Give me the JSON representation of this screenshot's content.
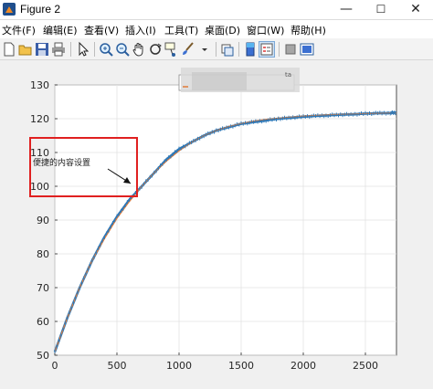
{
  "window": {
    "title": "Figure 2",
    "minimize": "—",
    "maximize": "☐",
    "close": "✕"
  },
  "menu": {
    "items": [
      "文件(F)",
      "编辑(E)",
      "查看(V)",
      "插入(I)",
      "工具(T)",
      "桌面(D)",
      "窗口(W)",
      "帮助(H)"
    ]
  },
  "toolbar": {
    "buttons": [
      {
        "name": "new-figure-icon"
      },
      {
        "name": "open-file-icon"
      },
      {
        "name": "save-icon"
      },
      {
        "name": "print-icon"
      },
      {
        "name": "pointer-icon"
      },
      {
        "name": "zoom-in-icon"
      },
      {
        "name": "zoom-out-icon"
      },
      {
        "name": "pan-icon"
      },
      {
        "name": "rotate-3d-icon"
      },
      {
        "name": "data-cursor-icon"
      },
      {
        "name": "brush-icon"
      },
      {
        "name": "link-plot-icon"
      },
      {
        "name": "insert-colorbar-icon"
      },
      {
        "name": "insert-legend-icon"
      },
      {
        "name": "hide-plot-tools-icon"
      },
      {
        "name": "show-plot-tools-icon"
      }
    ]
  },
  "annotation": {
    "text": "便捷的内容设置",
    "box_color": "#e02020"
  },
  "legend": {
    "visible_fragment": "ta"
  },
  "colors": {
    "series_data": "#2e78b7",
    "series_fit": "#e07b39"
  },
  "chart_data": {
    "type": "line",
    "title": "",
    "xlabel": "",
    "ylabel": "",
    "xlim": [
      0,
      2750
    ],
    "ylim": [
      50,
      130
    ],
    "xticks": [
      0,
      500,
      1000,
      1500,
      2000,
      2500
    ],
    "yticks": [
      50,
      60,
      70,
      80,
      90,
      100,
      110,
      120,
      130
    ],
    "grid": true,
    "series": [
      {
        "x": [
          0,
          100,
          200,
          300,
          400,
          500,
          600,
          700,
          800,
          900,
          1000,
          1100,
          1200,
          1300,
          1400,
          1500,
          1600,
          1700,
          1800,
          1900,
          2000,
          2100,
          2200,
          2300,
          2400,
          2500,
          2600,
          2700,
          2750
        ],
        "y": [
          51,
          61,
          70,
          78,
          85,
          91,
          96,
          100,
          104,
          108,
          111,
          113,
          115,
          116.5,
          117.5,
          118.5,
          119,
          119.5,
          120,
          120.3,
          120.6,
          120.8,
          121,
          121.2,
          121.3,
          121.5,
          121.6,
          121.7,
          121.8
        ]
      },
      {
        "x": [
          0,
          100,
          200,
          300,
          400,
          500,
          600,
          700,
          800,
          900,
          1000,
          1100,
          1200,
          1300,
          1400,
          1500,
          1600,
          1700,
          1800,
          1900,
          2000,
          2100,
          2200,
          2300,
          2400,
          2500,
          2600,
          2700,
          2750
        ],
        "y": [
          51,
          61,
          70,
          78,
          84.5,
          90.5,
          95.5,
          100,
          104,
          107.5,
          110.5,
          113,
          115,
          116.5,
          117.7,
          118.6,
          119.3,
          119.8,
          120.2,
          120.5,
          120.8,
          121,
          121.2,
          121.3,
          121.4,
          121.5,
          121.6,
          121.7,
          121.7
        ]
      }
    ]
  }
}
